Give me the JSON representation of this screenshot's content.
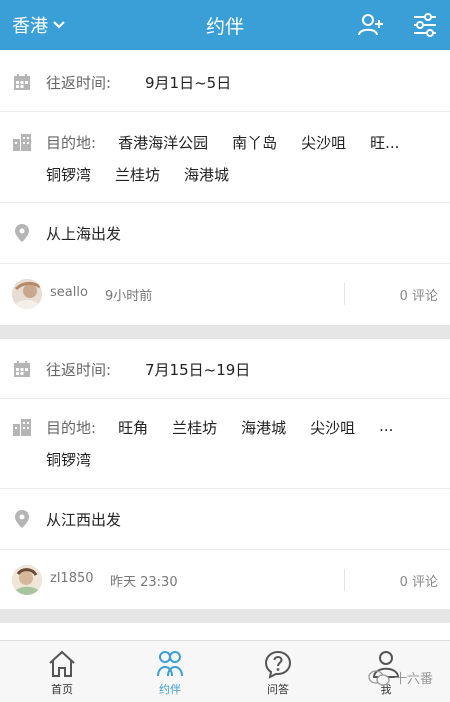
{
  "header": {
    "city": "香港",
    "title": "约伴"
  },
  "labels": {
    "round_trip": "往返时间:",
    "destination": "目的地:",
    "comment_suffix": "评论"
  },
  "posts": [
    {
      "date_range": "9月1日~5日",
      "destinations_line1": [
        "香港海洋公园",
        "南丫岛",
        "尖沙咀",
        "旺..."
      ],
      "destinations_line2": [
        "铜锣湾",
        "兰桂坊",
        "海港城"
      ],
      "departure": "从上海出发",
      "user": "seallo",
      "time": "9小时前",
      "comments": "0 评论"
    },
    {
      "date_range": "7月15日~19日",
      "destinations_line1": [
        "旺角",
        "兰桂坊",
        "海港城",
        "尖沙咀",
        "..."
      ],
      "destinations_line2": [
        "铜锣湾"
      ],
      "departure": "从江西出发",
      "user": "zl1850",
      "time": "昨天 23:30",
      "comments": "0 评论"
    }
  ],
  "tabs": [
    {
      "label": "首页",
      "icon": "home-icon"
    },
    {
      "label": "约伴",
      "icon": "companions-icon",
      "active": true
    },
    {
      "label": "问答",
      "icon": "qa-icon"
    },
    {
      "label": "我",
      "icon": "profile-icon"
    }
  ],
  "watermark": "十六番",
  "colors": {
    "accent": "#3a9fd6",
    "icon_gray": "#b5b5b5"
  }
}
